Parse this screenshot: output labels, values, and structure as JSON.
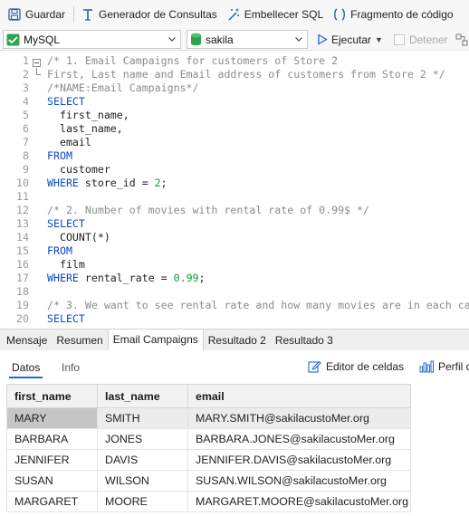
{
  "toolbar": {
    "save": "Guardar",
    "query_builder": "Generador de Consultas",
    "beautify": "Embellecer SQL",
    "snippet": "Fragmento de código"
  },
  "connection": {
    "engine": "MySQL",
    "database": "sakila",
    "run": "Ejecutar",
    "stop": "Detener"
  },
  "editor": {
    "lines": [
      {
        "n": "1",
        "tokens": [
          {
            "t": "/* 1. Email Campaigns for customers of Store 2",
            "c": "cm"
          }
        ]
      },
      {
        "n": "2",
        "tokens": [
          {
            "t": "First, Last name and Email address of customers from Store 2 */",
            "c": "cm"
          }
        ]
      },
      {
        "n": "3",
        "tokens": [
          {
            "t": "/*NAME:Email Campaigns*/",
            "c": "cm"
          }
        ]
      },
      {
        "n": "4",
        "tokens": [
          {
            "t": "SELECT",
            "c": "kw"
          }
        ]
      },
      {
        "n": "5",
        "tokens": [
          {
            "t": "  first_name,",
            "c": "tx"
          }
        ]
      },
      {
        "n": "6",
        "tokens": [
          {
            "t": "  last_name,",
            "c": "tx"
          }
        ]
      },
      {
        "n": "7",
        "tokens": [
          {
            "t": "  email",
            "c": "tx"
          }
        ]
      },
      {
        "n": "8",
        "tokens": [
          {
            "t": "FROM",
            "c": "kw"
          }
        ]
      },
      {
        "n": "9",
        "tokens": [
          {
            "t": "  customer",
            "c": "tx"
          }
        ]
      },
      {
        "n": "10",
        "tokens": [
          {
            "t": "WHERE",
            "c": "kw"
          },
          {
            "t": " store_id = ",
            "c": "tx"
          },
          {
            "t": "2",
            "c": "num"
          },
          {
            "t": ";",
            "c": "tx"
          }
        ]
      },
      {
        "n": "11",
        "tokens": []
      },
      {
        "n": "12",
        "tokens": [
          {
            "t": "/* 2. Number of movies with rental rate of 0.99$ */",
            "c": "cm"
          }
        ]
      },
      {
        "n": "13",
        "tokens": [
          {
            "t": "SELECT",
            "c": "kw"
          }
        ]
      },
      {
        "n": "14",
        "tokens": [
          {
            "t": "  COUNT(*)",
            "c": "tx"
          }
        ]
      },
      {
        "n": "15",
        "tokens": [
          {
            "t": "FROM",
            "c": "kw"
          }
        ]
      },
      {
        "n": "16",
        "tokens": [
          {
            "t": "  film",
            "c": "tx"
          }
        ]
      },
      {
        "n": "17",
        "tokens": [
          {
            "t": "WHERE",
            "c": "kw"
          },
          {
            "t": " rental_rate = ",
            "c": "tx"
          },
          {
            "t": "0.99",
            "c": "num"
          },
          {
            "t": ";",
            "c": "tx"
          }
        ]
      },
      {
        "n": "18",
        "tokens": []
      },
      {
        "n": "19",
        "tokens": [
          {
            "t": "/* 3. We want to see rental rate and how many movies are in each ca",
            "c": "cm"
          }
        ]
      },
      {
        "n": "20",
        "tokens": [
          {
            "t": "SELECT",
            "c": "kw"
          }
        ]
      }
    ]
  },
  "result_tabs": [
    "Mensaje",
    "Resumen",
    "Email Campaigns",
    "Resultado 2",
    "Resultado 3"
  ],
  "active_result_tab": "Email Campaigns",
  "subbar": {
    "data_tab": "Datos",
    "info_tab": "Info",
    "cell_editor": "Editor de celdas",
    "profile": "Perfil d"
  },
  "grid": {
    "columns": [
      "first_name",
      "last_name",
      "email"
    ],
    "rows": [
      [
        "MARY",
        "SMITH",
        "MARY.SMITH@sakilacustoMer.org"
      ],
      [
        "BARBARA",
        "JONES",
        "BARBARA.JONES@sakilacustoMer.org"
      ],
      [
        "JENNIFER",
        "DAVIS",
        "JENNIFER.DAVIS@sakilacustoMer.org"
      ],
      [
        "SUSAN",
        "WILSON",
        "SUSAN.WILSON@sakilacustoMer.org"
      ],
      [
        "MARGARET",
        "MOORE",
        "MARGARET.MOORE@sakilacustoMer.org"
      ]
    ]
  },
  "colors": {
    "accent": "#1b6ad8",
    "keyword": "#0b49c6",
    "comment": "#8c8c8c",
    "number": "#109e37",
    "db_icon": "#2ea44f"
  }
}
